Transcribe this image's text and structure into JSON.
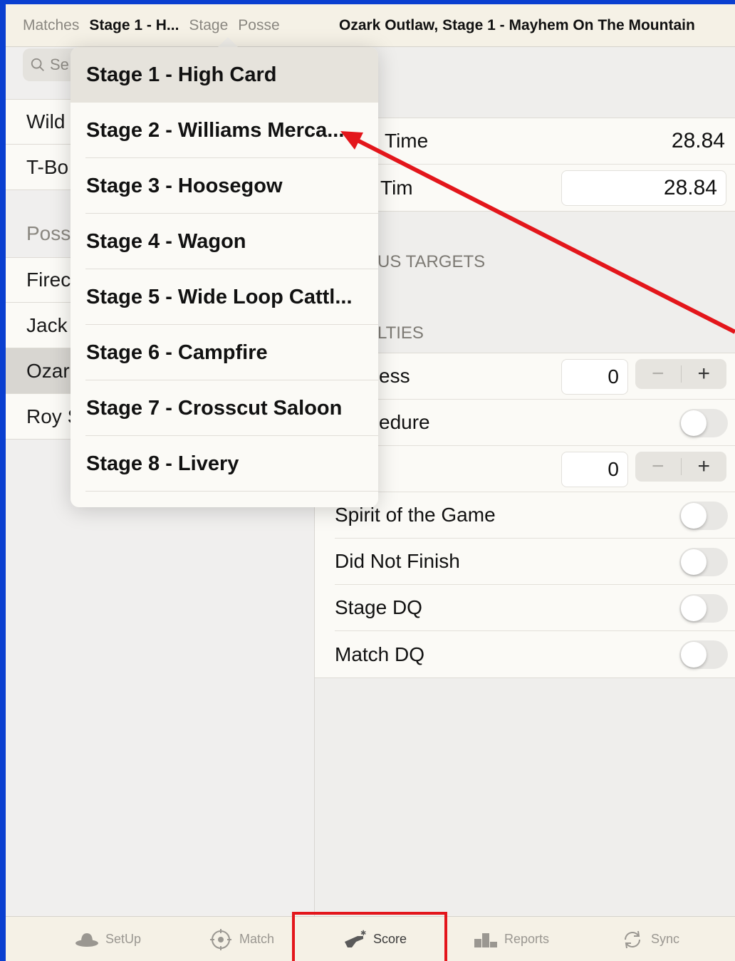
{
  "left_nav": {
    "items": [
      "Matches",
      "Stage 1 - H...",
      "Stage",
      "Posse"
    ]
  },
  "search": {
    "placeholder": "Se"
  },
  "shooters": {
    "group1": [
      "Wild",
      "T-Bo"
    ],
    "section_header": "Poss",
    "group2": [
      "Firec",
      "Jack",
      "Ozar",
      "Roy S"
    ],
    "selected": "Ozar"
  },
  "right_nav": {
    "title": "Ozark Outlaw, Stage 1 - Mayhem On The Mountain"
  },
  "time_section": {
    "row1_label": "Time",
    "row1_value": "28.84",
    "row2_label": "Tim",
    "row2_value": "28.84"
  },
  "bonus_section_label": "US TARGETS",
  "penalties_section_label": "LTIES",
  "penalties": {
    "rows": [
      {
        "label": "ess",
        "control": "stepper",
        "value": "0"
      },
      {
        "label": "edure",
        "control": "toggle",
        "on": false
      },
      {
        "label": "",
        "control": "stepper",
        "value": "0"
      },
      {
        "label": "Spirit of the Game",
        "control": "toggle",
        "on": false
      },
      {
        "label": "Did Not Finish",
        "control": "toggle",
        "on": false
      },
      {
        "label": "Stage DQ",
        "control": "toggle",
        "on": false
      },
      {
        "label": "Match DQ",
        "control": "toggle",
        "on": false
      }
    ],
    "minus": "−",
    "plus": "+"
  },
  "stage_menu": {
    "items": [
      "Stage 1 - High Card",
      "Stage 2 - Williams Merca...",
      "Stage 3 - Hoosegow",
      "Stage 4 - Wagon",
      "Stage 5 - Wide Loop Cattl...",
      "Stage 6 - Campfire",
      "Stage 7 - Crosscut Saloon",
      "Stage 8 - Livery"
    ],
    "selected_index": 0
  },
  "tabbar": {
    "setup": "SetUp",
    "match": "Match",
    "score": "Score",
    "reports": "Reports",
    "sync": "Sync",
    "active": "Score"
  },
  "colors": {
    "outer_background": "#0a3fd0",
    "annotation_red": "#e3161b",
    "bar_background": "#f5f1e6"
  }
}
